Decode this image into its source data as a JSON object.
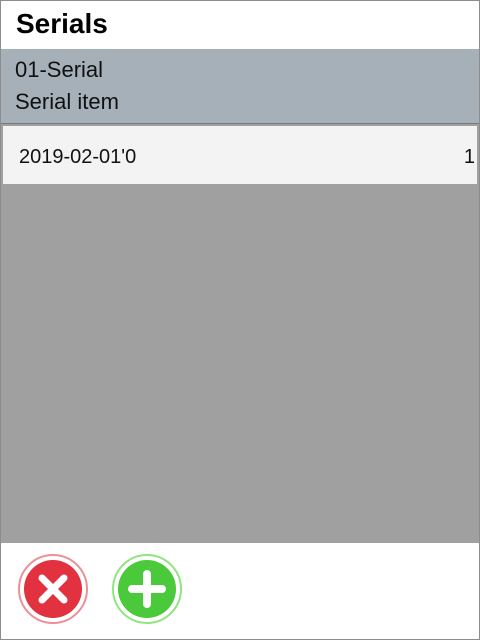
{
  "header": {
    "title": "Serials"
  },
  "item": {
    "code": "01-Serial",
    "description": "Serial item"
  },
  "serials": [
    {
      "value": "2019-02-01'0",
      "quantity": "1"
    }
  ],
  "footer": {
    "cancel_icon": "cancel-x-icon",
    "add_icon": "add-plus-icon"
  },
  "colors": {
    "header_bg": "#a6b0b8",
    "list_bg": "#a0a0a0",
    "cancel_red": "#e2323f",
    "add_green": "#4ac93a"
  }
}
